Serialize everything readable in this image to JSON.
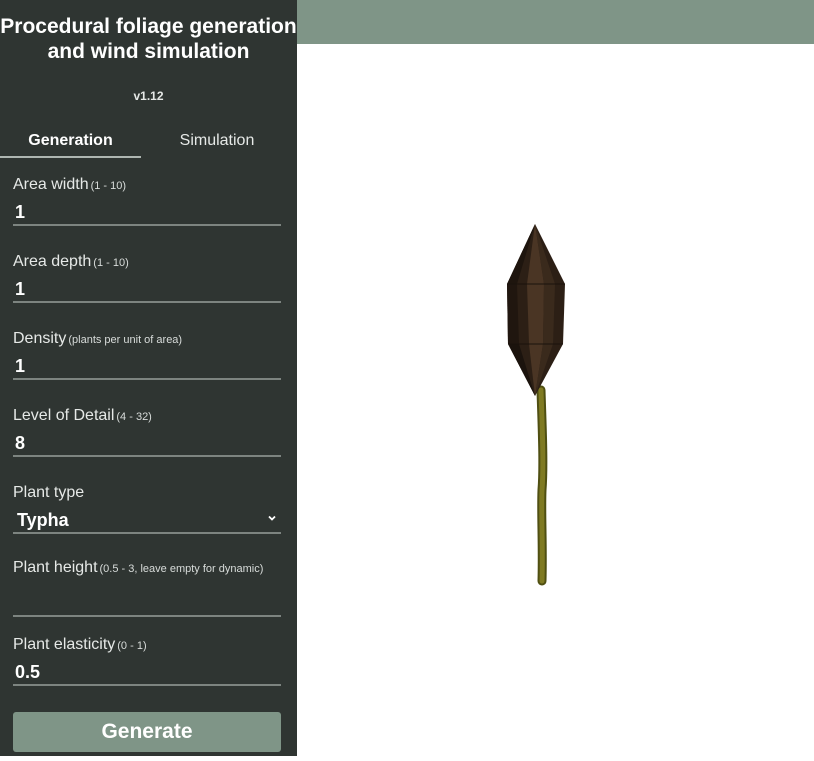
{
  "app": {
    "title": "Procedural foliage generation and wind simulation",
    "version": "v1.12"
  },
  "tabs": [
    {
      "label": "Generation",
      "active": true
    },
    {
      "label": "Simulation",
      "active": false
    }
  ],
  "fields": {
    "area_width": {
      "label": "Area width",
      "hint": "(1 - 10)",
      "value": "1"
    },
    "area_depth": {
      "label": "Area depth",
      "hint": "(1 - 10)",
      "value": "1"
    },
    "density": {
      "label": "Density",
      "hint": "(plants per unit of area)",
      "value": "1"
    },
    "lod": {
      "label": "Level of Detail",
      "hint": "(4 - 32)",
      "value": "8"
    },
    "plant_type": {
      "label": "Plant type",
      "value": "Typha"
    },
    "plant_height": {
      "label": "Plant height",
      "hint": "(0.5 - 3, leave empty for dynamic)",
      "value": ""
    },
    "plant_elasticity": {
      "label": "Plant elasticity",
      "hint": "(0 - 1)",
      "value": "0.5"
    }
  },
  "generate_label": "Generate",
  "colors": {
    "sidebar_bg": "#2f3532",
    "accent": "#7f9587",
    "plant_head": "#3a2a1e",
    "plant_stem": "#6b6a1c"
  },
  "icons": {
    "plant_type_dropdown": "chevron-down-icon"
  }
}
